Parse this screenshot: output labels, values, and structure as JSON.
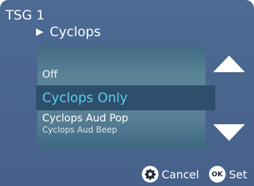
{
  "header": {
    "title": "TSG 1",
    "subtitle": "Cyclops"
  },
  "list": {
    "items": [
      {
        "label": "Off",
        "selected": false
      },
      {
        "label": "Cyclops Only",
        "selected": true
      },
      {
        "label": "Cyclops Aud Pop",
        "selected": false
      },
      {
        "label": "Cyclops Aud Beep",
        "selected": false
      }
    ]
  },
  "footer": {
    "cancel_label": "Cancel",
    "ok_badge": "OK",
    "set_label": "Set"
  },
  "colors": {
    "background": "#4a6690",
    "selection": "#2e4f6c",
    "selected_text": "#58d0ee"
  },
  "icons": {
    "subtitle": "play-triangle-icon",
    "up": "arrow-up-icon",
    "down": "arrow-down-icon",
    "cancel": "gear-icon",
    "set": "ok-icon"
  }
}
